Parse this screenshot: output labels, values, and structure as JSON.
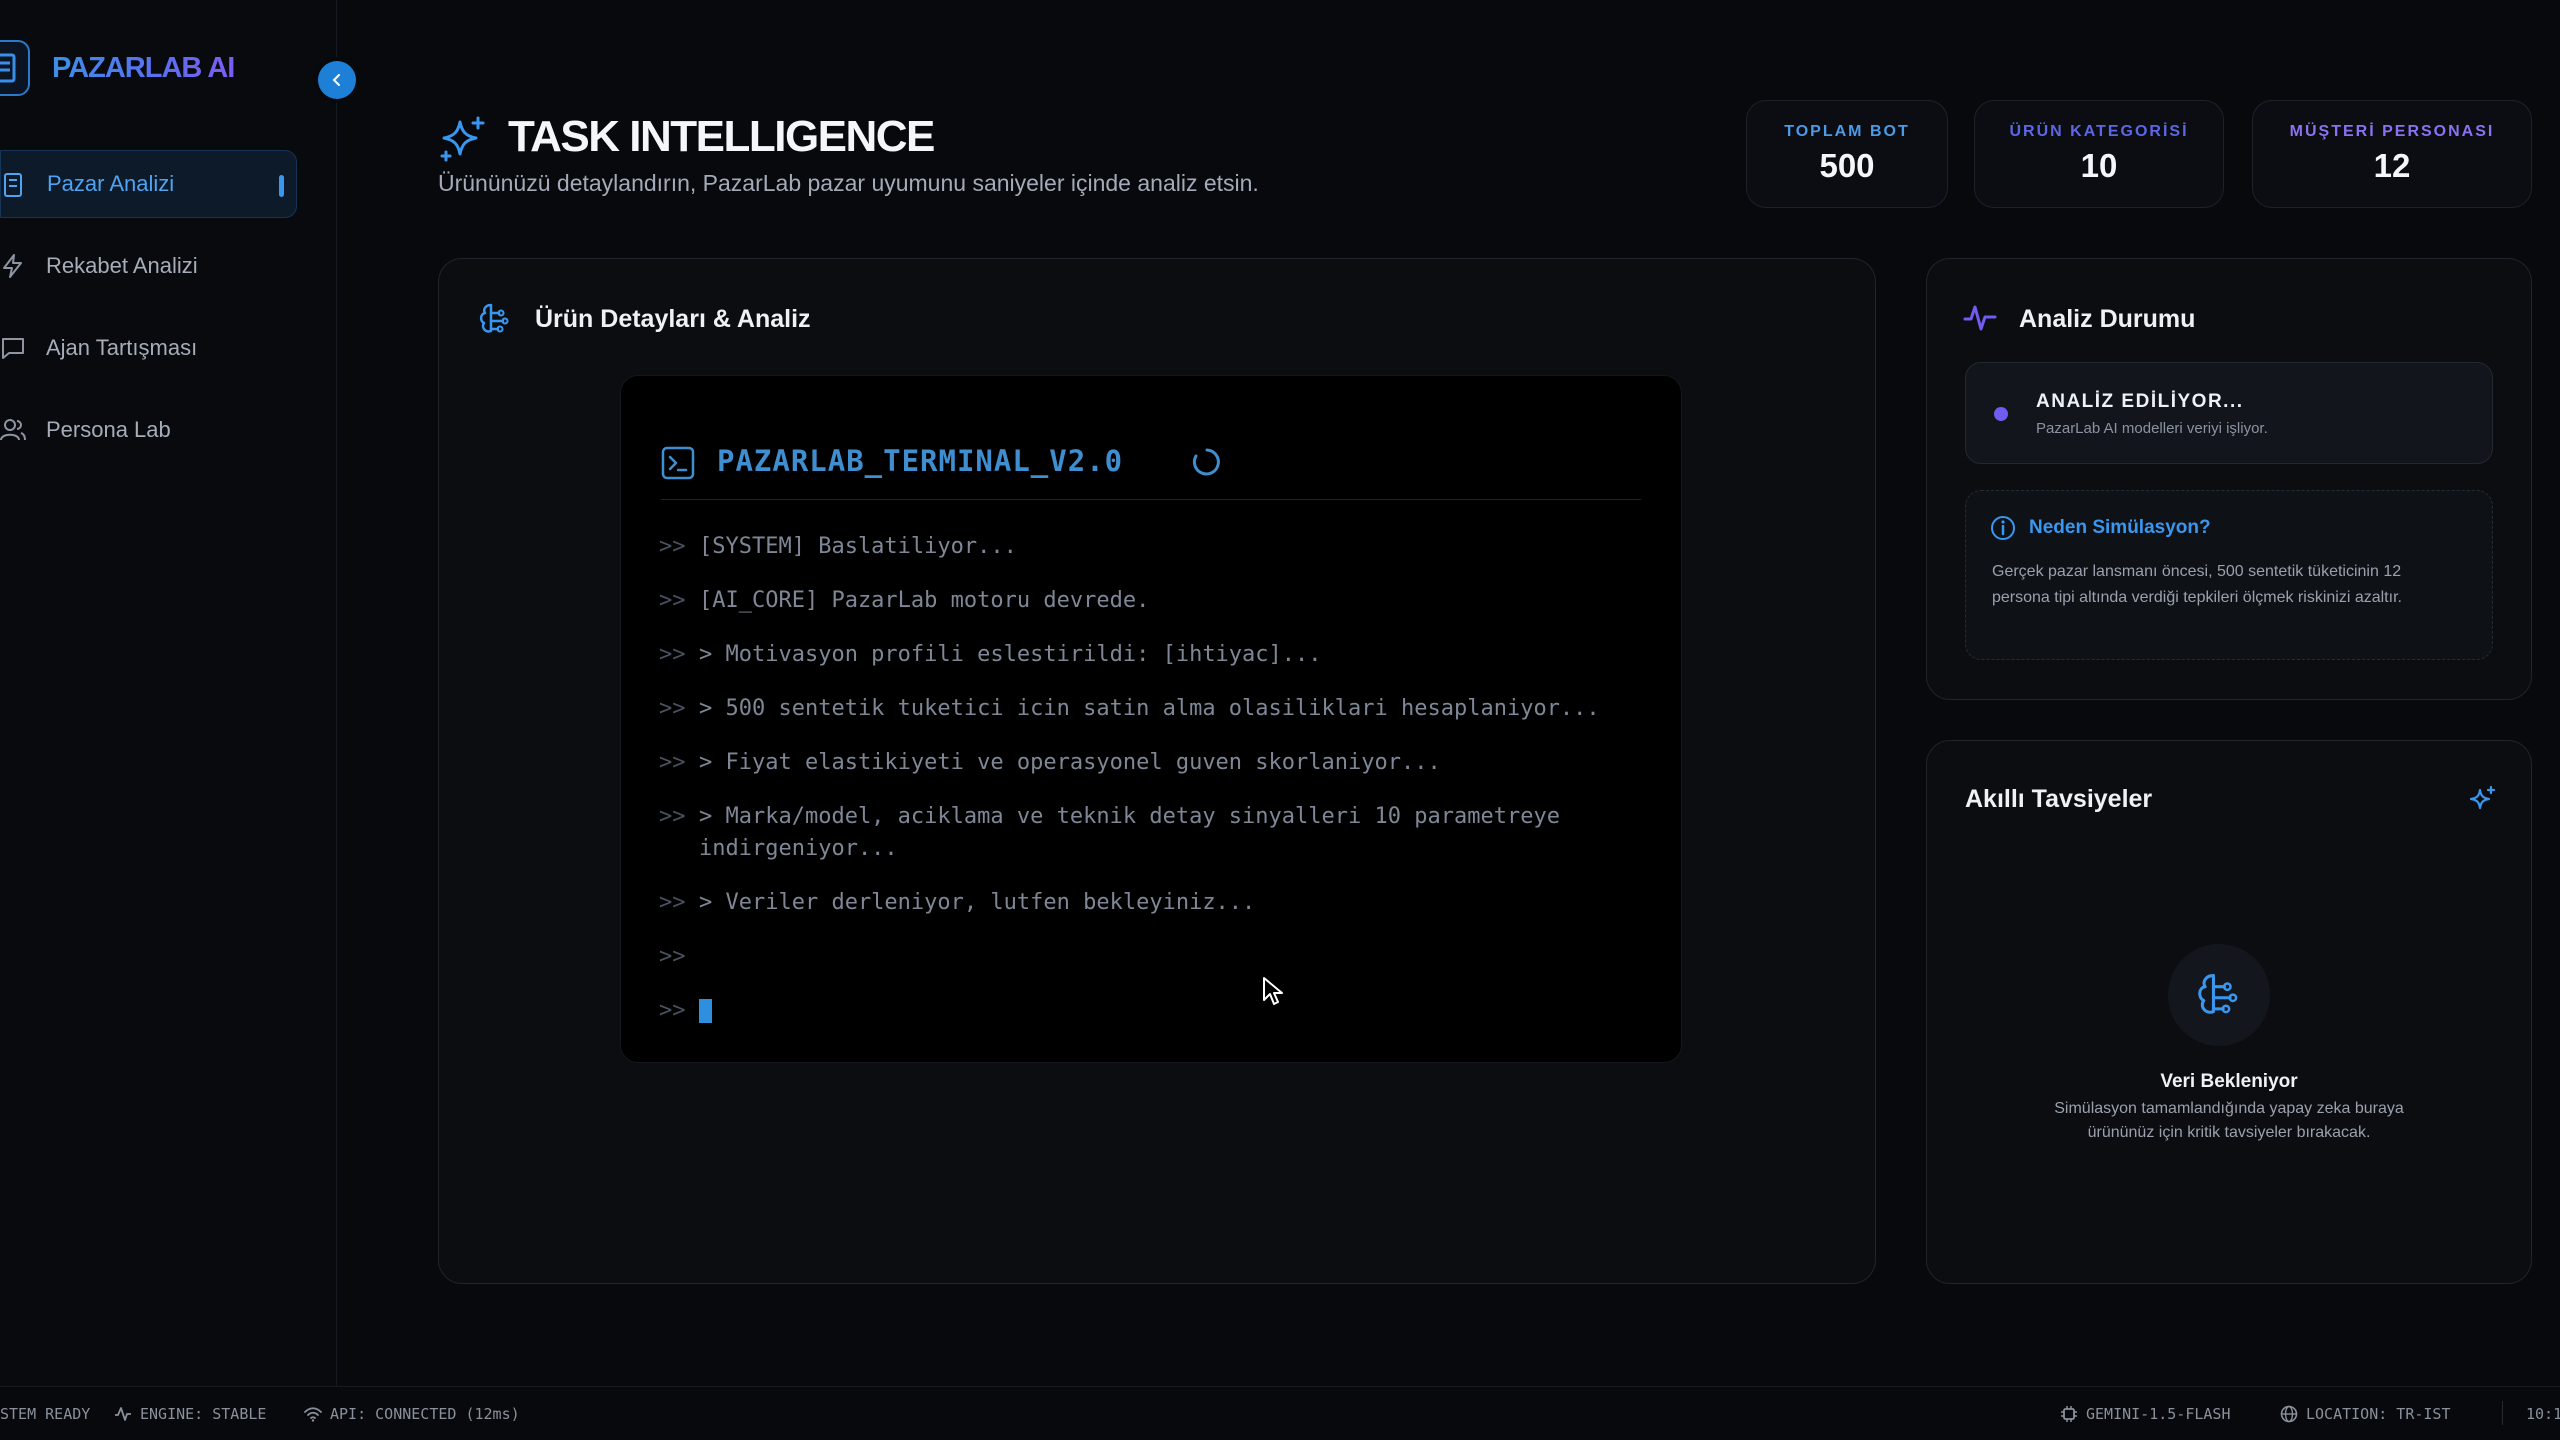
{
  "app": {
    "brand": "PAZARLAB AI"
  },
  "sidebar": {
    "items": [
      {
        "label": "Pazar Analizi",
        "icon": "building-icon",
        "active": true
      },
      {
        "label": "Rekabet Analizi",
        "icon": "lightning-icon",
        "active": false
      },
      {
        "label": "Ajan Tartışması",
        "icon": "chat-icon",
        "active": false
      },
      {
        "label": "Persona Lab",
        "icon": "users-icon",
        "active": false
      }
    ]
  },
  "header": {
    "title": "TASK INTELLIGENCE",
    "subtitle": "Ürününüzü detaylandırın, PazarLab pazar uyumunu saniyeler içinde analiz etsin."
  },
  "stats": [
    {
      "label": "TOPLAM BOT",
      "value": "500",
      "color": "#4b9be8"
    },
    {
      "label": "ÜRÜN KATEGORİSİ",
      "value": "10",
      "color": "#5d67e6"
    },
    {
      "label": "MÜŞTERİ PERSONASI",
      "value": "12",
      "color": "#8a72f0"
    }
  ],
  "main_panel": {
    "title": "Ürün Detayları & Analiz",
    "terminal": {
      "title": "PAZARLAB_TERMINAL_V2.0",
      "prompt": ">>",
      "lines": [
        "[SYSTEM] Baslatiliyor...",
        "[AI_CORE] PazarLab motoru devrede.",
        "> Motivasyon profili eslestirildi: [ihtiyac]...",
        "> 500 sentetik tuketici icin satin alma olasiliklari hesaplaniyor...",
        "> Fiyat elastikiyeti ve operasyonel guven skorlaniyor...",
        "> Marka/model, aciklama ve teknik detay sinyalleri 10 parametreye indirgeniyor...",
        "> Veriler derleniyor, lutfen bekleyiniz...",
        ""
      ]
    }
  },
  "analysis_status": {
    "title": "Analiz Durumu",
    "state_title": "ANALİZ EDİLİYOR...",
    "state_desc": "PazarLab AI modelleri veriyi işliyor.",
    "why_title": "Neden Simülasyon?",
    "why_text": "Gerçek pazar lansmanı öncesi, 500 sentetik tüketicinin 12 persona tipi altında verdiği tepkileri ölçmek riskinizi azaltır."
  },
  "recommendations": {
    "title": "Akıllı Tavsiyeler",
    "empty_title": "Veri Bekleniyor",
    "empty_text": "Simülasyon tamamlandığında yapay zeka buraya ürününüz için kritik tavsiyeler bırakacak."
  },
  "statusbar": {
    "system": "STEM READY",
    "engine": "ENGINE: STABLE",
    "api": "API: CONNECTED (12ms)",
    "model": "GEMINI-1.5-FLASH",
    "location": "LOCATION: TR-IST",
    "time": "10:1"
  },
  "colors": {
    "accent": "#3a97f0",
    "background": "#07090d",
    "status_dot": "#6f5cf0"
  }
}
